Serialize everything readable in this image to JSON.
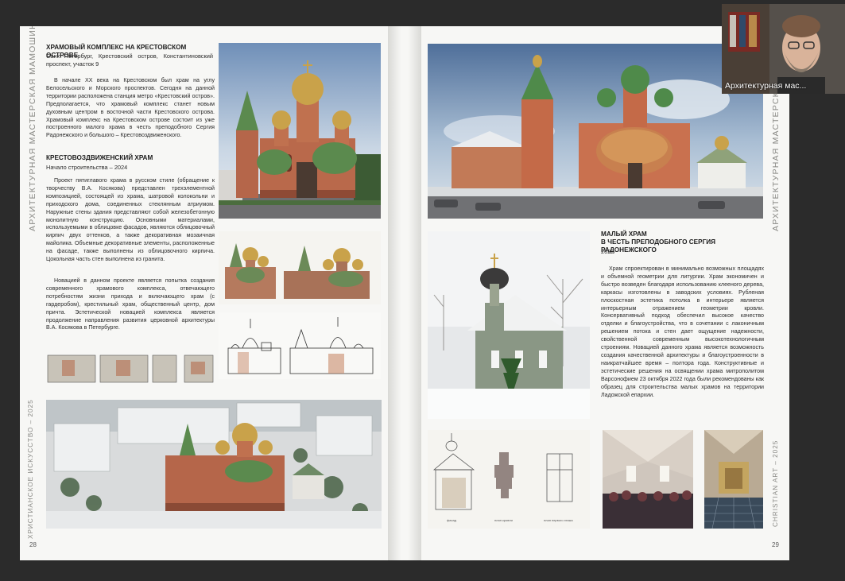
{
  "spread": {
    "left_margin_vertical": "АРХИТЕКТУРНАЯ МАСТЕРСКАЯ МАМОШИНА",
    "left_footer_vertical": "ХРИСТИАНСКОЕ ИСКУССТВО – 2025",
    "right_margin_vertical": "АРХИТЕКТУРНАЯ МАСТЕРСКАЯ МАМОШИНА",
    "right_footer_vertical": "CHRISTIAN ART – 2025",
    "page_left_number": "28",
    "page_right_number": "29"
  },
  "left": {
    "title": "ХРАМОВЫЙ КОМПЛЕКС НА КРЕСТОВСКОМ ОСТРОВЕ",
    "address": "Санкт-Петербург, Крестовский остров, Константиновский проспект, участок 9",
    "intro": "В начале XX века на Крестовском был храм на углу Белосельского и Морского проспектов. Сегодня на данной территории расположена станция метро «Крестовский остров». Предполагается, что храмовый комплекс станет новым духовным центром в восточной части Крестовского острова. Храмовый комплекс на Крестовском острове состоит из уже построенного малого храма в честь преподобного Сергия Радонежского и большого – Крестовоздвиженского.",
    "subtitle": "КРЕСТОВОЗДВИЖЕНСКИЙ ХРАМ",
    "start": "Начало строительства – 2024",
    "para1": "Проект пятиглавого храма в русском стиле (обращение к творчеству В.А. Косякова) представлен трехэлементной композицией, состоящей из храма, шатровой колокольни и приходского дома, соединенных стеклянным атриумом. Наружные стены здания представляют собой железобетонную монолитную конструкцию. Основными материалами, используемыми в облицовке фасадов, являются облицовочный кирпич двух оттенков, а также декоративная мозаичная майолика. Объемные декоративные элементы, расположенные на фасаде, также выполнены из облицовочного кирпича. Цокольная часть стен выполнена из гранита.",
    "para2": "Новацией в данном проекте является попытка создания современного храмового комплекса, отвечающего потребностям жизни прихода и включающего храм (с гардеробом), крестильный храм, общественный центр, дом причта. Эстетической новацией комплекса является продолжение направления развития церковной архитектуры В.А. Косякова в Петербурге."
  },
  "right": {
    "title_line1": "МАЛЫЙ ХРАМ",
    "title_line2": "В ЧЕСТЬ ПРЕПОДОБНОГО СЕРГИЯ РАДОНЕЖСКОГО",
    "year": "2022",
    "para": "Храм спроектирован в минимально возможных площадях и объемной геометрии для литургии. Храм экономичен и быстро возведен благодаря использованию клееного дерева, каркасы изготовлены в заводских условиях. Рубленая плоскостная эстетика потолка в интерьере является интерьерным отражением геометрии кровли. Консервативный подход обеспечил высокое качество отделки и благоустройства, что в сочетании с лаконичным решением потока и стен дает ощущение надежности, свойственной современным высокотехнологичным строениям. Новацией данного храма является возможность создания качественной архитектуры и благоустроенности в наикратчайшее время – полтора года. Конструктивные и эстетические решения на освящении храма митрополитом Варсонофием 23 октября 2022 года были рекомендованы как образец для строительства малых храмов на территории Ладожской епархии.",
    "drawing_labels": [
      "фасад",
      "план кровли",
      "план первого этажа"
    ]
  },
  "webcam": {
    "label": "Архитектурная мас..."
  },
  "colors": {
    "page": "#f7f7f5",
    "background": "#2b2b2b",
    "brick": "#b5664a",
    "green_dome": "#5b8a4e",
    "gold": "#c9a24a"
  }
}
